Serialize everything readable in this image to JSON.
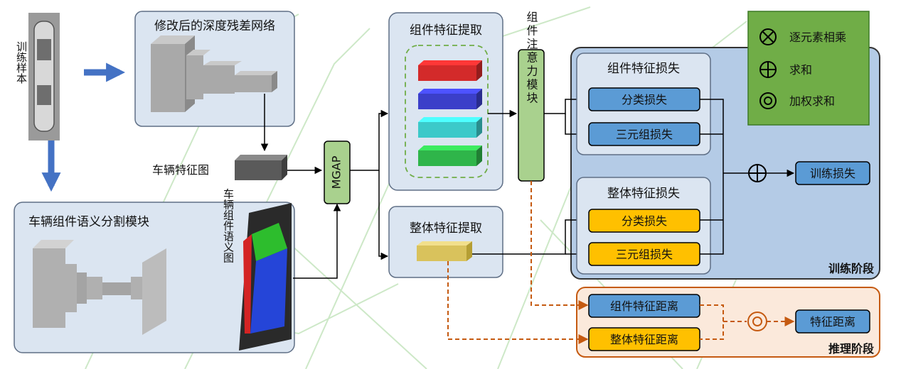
{
  "training_sample": {
    "label": "训练样本"
  },
  "resnet": {
    "title": "修改后的深度残差网络"
  },
  "feature_map": {
    "label": "车辆特征图"
  },
  "segmentation": {
    "title": "车辆组件语义分割模块",
    "map_label": "车辆组件语义图"
  },
  "mgap": {
    "label": "MGAP"
  },
  "component_extract": {
    "title": "组件特征提取",
    "bar_colors": [
      "#d32a2a",
      "#3b3fc9",
      "#3cc9c9",
      "#2fb54a"
    ]
  },
  "global_extract": {
    "title": "整体特征提取"
  },
  "attention": {
    "label": "组件注意力模块"
  },
  "component_loss": {
    "title": "组件特征损失",
    "classification": "分类损失",
    "triplet": "三元组损失"
  },
  "global_loss": {
    "title": "整体特征损失",
    "classification": "分类损失",
    "triplet": "三元组损失"
  },
  "training_loss": {
    "label": "训练损失"
  },
  "training_stage": {
    "label": "训练阶段"
  },
  "inference": {
    "component_distance": "组件特征距离",
    "global_distance": "整体特征距离",
    "feature_distance": "特征距离",
    "stage_label": "推理阶段"
  },
  "legend": {
    "items": [
      {
        "icon": "otimes",
        "label": "逐元素相乘"
      },
      {
        "icon": "oplus",
        "label": "求和"
      },
      {
        "icon": "odot",
        "label": "加权求和"
      }
    ]
  },
  "colors": {
    "panel": "#dbe5f1",
    "panel_border": "#5f6f86",
    "blue_box": "#5b9bd5",
    "orange_box": "#ffc000",
    "legend_green": "#70ad47",
    "green_box": "#a9d18e",
    "stage_fill": "#b4cbe6",
    "inference_border": "#c55a11",
    "arrow_blue": "#4472c4"
  }
}
